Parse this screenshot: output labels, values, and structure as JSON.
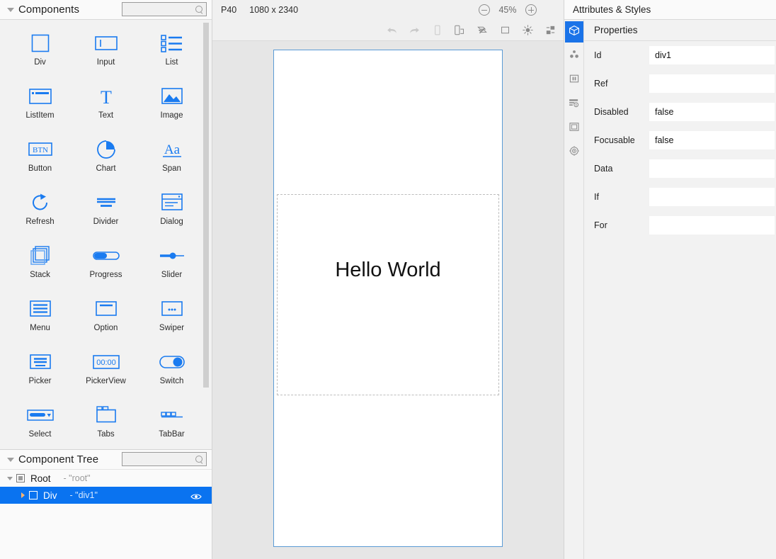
{
  "left": {
    "components_header": {
      "title": "Components",
      "search_placeholder": "",
      "search_value": ""
    },
    "palette": [
      {
        "label": "Div",
        "icon": "div-icon"
      },
      {
        "label": "Input",
        "icon": "input-icon"
      },
      {
        "label": "List",
        "icon": "list-icon"
      },
      {
        "label": "ListItem",
        "icon": "listitem-icon"
      },
      {
        "label": "Text",
        "icon": "text-icon"
      },
      {
        "label": "Image",
        "icon": "image-icon"
      },
      {
        "label": "Button",
        "icon": "button-icon"
      },
      {
        "label": "Chart",
        "icon": "chart-icon"
      },
      {
        "label": "Span",
        "icon": "span-icon"
      },
      {
        "label": "Refresh",
        "icon": "refresh-icon"
      },
      {
        "label": "Divider",
        "icon": "divider-icon"
      },
      {
        "label": "Dialog",
        "icon": "dialog-icon"
      },
      {
        "label": "Stack",
        "icon": "stack-icon"
      },
      {
        "label": "Progress",
        "icon": "progress-icon"
      },
      {
        "label": "Slider",
        "icon": "slider-icon"
      },
      {
        "label": "Menu",
        "icon": "menu-icon"
      },
      {
        "label": "Option",
        "icon": "option-icon"
      },
      {
        "label": "Swiper",
        "icon": "swiper-icon"
      },
      {
        "label": "Picker",
        "icon": "picker-icon"
      },
      {
        "label": "PickerView",
        "icon": "pickerview-icon"
      },
      {
        "label": "Switch",
        "icon": "switch-icon"
      },
      {
        "label": "Select",
        "icon": "select-icon"
      },
      {
        "label": "Tabs",
        "icon": "tabs-icon"
      },
      {
        "label": "TabBar",
        "icon": "tabbar-icon"
      }
    ],
    "tree_header": {
      "title": "Component Tree",
      "search_placeholder": "",
      "search_value": ""
    },
    "tree_rows": [
      {
        "name": "Root",
        "sub": "- \"root\"",
        "selected": false
      },
      {
        "name": "Div",
        "sub": "- \"div1\"",
        "selected": true
      }
    ]
  },
  "center": {
    "device_name": "P40",
    "resolution": "1080 x 2340",
    "zoom_level": "45%",
    "zoom_out_label": "-",
    "zoom_in_label": "+",
    "toolbar_icons": [
      "undo-icon",
      "redo-icon",
      "phone-portrait-icon",
      "phone-rotate-icon",
      "inspect-icon",
      "square-icon",
      "brightness-icon",
      "layout-icon"
    ],
    "preview_text": "Hello World"
  },
  "right": {
    "header_title": "Attributes & Styles",
    "vtabs": [
      {
        "icon": "cube-icon",
        "active": true
      },
      {
        "icon": "atoms-icon",
        "active": false
      },
      {
        "icon": "columns-icon",
        "active": false
      },
      {
        "icon": "form-info-icon",
        "active": false
      },
      {
        "icon": "frame-icon",
        "active": false
      },
      {
        "icon": "settings-icon",
        "active": false
      }
    ],
    "properties_title": "Properties",
    "properties": [
      {
        "label": "Id",
        "value": "div1",
        "placeholder": ""
      },
      {
        "label": "Ref",
        "value": "",
        "placeholder": ""
      },
      {
        "label": "Disabled",
        "value": "false",
        "placeholder": ""
      },
      {
        "label": "Focusable",
        "value": "false",
        "placeholder": ""
      },
      {
        "label": "Data",
        "value": "",
        "placeholder": ""
      },
      {
        "label": "If",
        "value": "",
        "placeholder": ""
      },
      {
        "label": "For",
        "value": "",
        "placeholder": ""
      }
    ]
  },
  "colors": {
    "accent_blue": "#1a73e8",
    "icon_blue": "#1a7bf0",
    "selection_blue": "#0a73f0",
    "device_border": "#5b9bd5",
    "panel_bg": "#f2f2f2",
    "canvas_bg": "#e6e6e6"
  }
}
